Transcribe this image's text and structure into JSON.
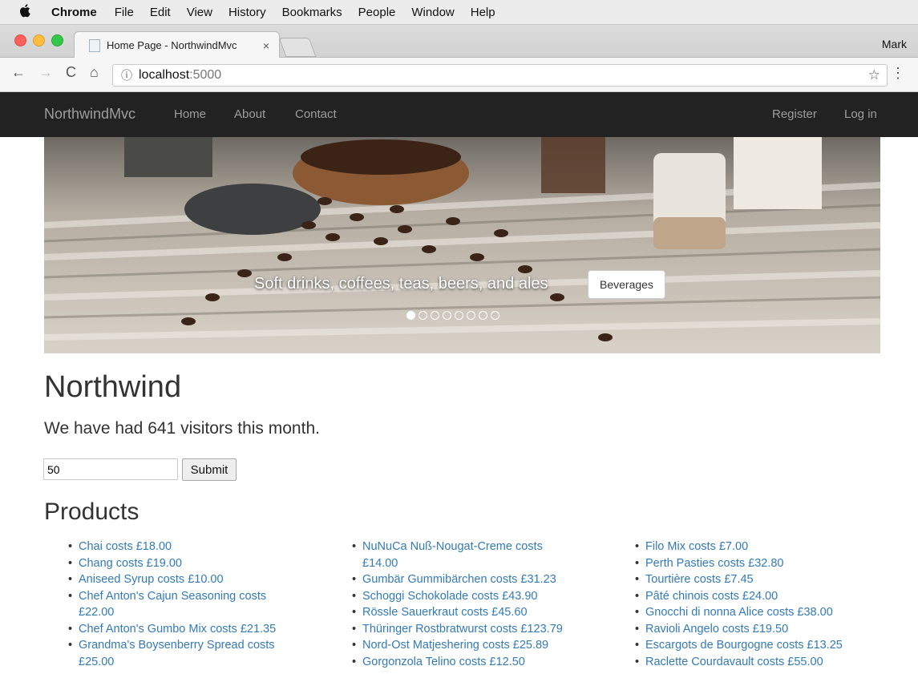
{
  "menubar": {
    "apple_icon": "apple-logo-icon",
    "app_name": "Chrome",
    "items": [
      "File",
      "Edit",
      "View",
      "History",
      "Bookmarks",
      "People",
      "Window",
      "Help"
    ]
  },
  "browser": {
    "tab_title": "Home Page - NorthwindMvc",
    "tab_close": "×",
    "profile": "Mark",
    "url_host": "localhost",
    "url_port": ":5000"
  },
  "site": {
    "brand": "NorthwindMvc",
    "nav": [
      "Home",
      "About",
      "Contact"
    ],
    "nav_right": [
      "Register",
      "Log in"
    ]
  },
  "carousel": {
    "caption": "Soft drinks, coffees, teas, beers, and ales",
    "button": "Beverages",
    "slide_count": 8,
    "active_index": 0
  },
  "content": {
    "title": "Northwind",
    "lead": "We have had 641 visitors this month.",
    "input_value": "50",
    "submit_label": "Submit",
    "products_heading": "Products"
  },
  "products": {
    "col1": [
      "Chai costs £18.00",
      "Chang costs £19.00",
      "Aniseed Syrup costs £10.00",
      "Chef Anton's Cajun Seasoning costs £22.00",
      "Chef Anton's Gumbo Mix costs £21.35",
      "Grandma's Boysenberry Spread costs £25.00"
    ],
    "col2": [
      "NuNuCa Nuß-Nougat-Creme costs £14.00",
      "Gumbär Gummibärchen costs £31.23",
      "Schoggi Schokolade costs £43.90",
      "Rössle Sauerkraut costs £45.60",
      "Thüringer Rostbratwurst costs £123.79",
      "Nord-Ost Matjeshering costs £25.89",
      "Gorgonzola Telino costs £12.50"
    ],
    "col3": [
      "Filo Mix costs £7.00",
      "Perth Pasties costs £32.80",
      "Tourtière costs £7.45",
      "Pâté chinois costs £24.00",
      "Gnocchi di nonna Alice costs £38.00",
      "Ravioli Angelo costs £19.50",
      "Escargots de Bourgogne costs £13.25",
      "Raclette Courdavault costs £55.00"
    ]
  },
  "colors": {
    "navbar_bg": "#222222",
    "link": "#337ab7"
  }
}
